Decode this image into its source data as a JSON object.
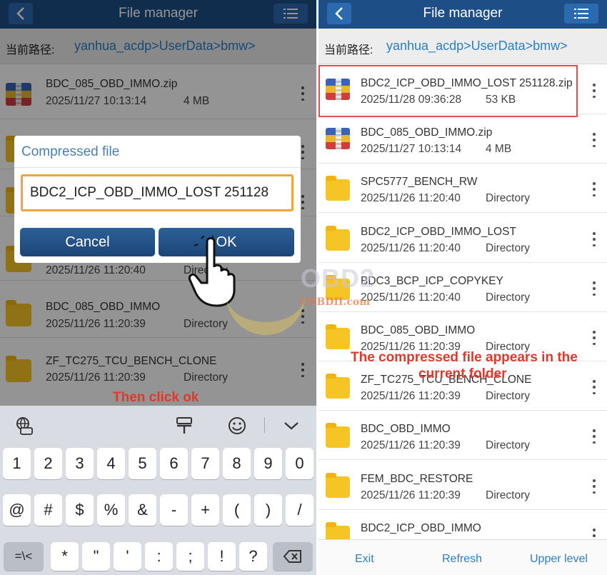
{
  "header": {
    "title": "File manager"
  },
  "path": {
    "label": "当前路径:",
    "value": "yanhua_acdp>UserData>bmw>"
  },
  "left_list": [
    {
      "name": "BDC_085_OBD_IMMO.zip",
      "date": "2025/11/27 10:13:14",
      "meta": "4 MB",
      "icon": "zip-icon"
    },
    {
      "name": "",
      "date": "2025/11/26 11:20:40",
      "meta": "Directory",
      "icon": "folder-icon"
    },
    {
      "name": "BDC_085_OBD_IMMO",
      "date": "2025/11/26 11:20:39",
      "meta": "Directory",
      "icon": "folder-icon"
    },
    {
      "name": "ZF_TC275_TCU_BENCH_CLONE",
      "date": "2025/11/26 11:20:39",
      "meta": "Directory",
      "icon": "folder-icon"
    }
  ],
  "dialog": {
    "title": "Compressed file",
    "value": "BDC2_ICP_OBD_IMMO_LOST 251128",
    "cancel_label": "Cancel",
    "ok_label": "OK"
  },
  "annotations": {
    "left": "Then click ok",
    "right_line1": "The compressed file appears in the",
    "right_line2": "current folder"
  },
  "keyboard": {
    "row1": [
      "1",
      "2",
      "3",
      "4",
      "5",
      "6",
      "7",
      "8",
      "9",
      "0"
    ],
    "row2": [
      "@",
      "#",
      "$",
      "%",
      "&",
      "-",
      "+",
      "(",
      ")",
      "/"
    ],
    "row3_switch": "=\\<",
    "row3": [
      "*",
      "\"",
      "'",
      ":",
      ";",
      "!",
      "?"
    ]
  },
  "right_list": [
    {
      "name": "BDC2_ICP_OBD_IMMO_LOST 251128.zip",
      "date": "2025/11/28 09:36:28",
      "meta": "53 KB",
      "icon": "zip-icon"
    },
    {
      "name": "BDC_085_OBD_IMMO.zip",
      "date": "2025/11/27 10:13:14",
      "meta": "4 MB",
      "icon": "zip-icon"
    },
    {
      "name": "SPC5777_BENCH_RW",
      "date": "2025/11/26 11:20:40",
      "meta": "Directory",
      "icon": "folder-icon"
    },
    {
      "name": "BDC2_ICP_OBD_IMMO_LOST",
      "date": "2025/11/26 11:20:40",
      "meta": "Directory",
      "icon": "folder-icon"
    },
    {
      "name": "BDC3_BCP_ICP_COPYKEY",
      "date": "2025/11/26 11:20:40",
      "meta": "Directory",
      "icon": "folder-icon"
    },
    {
      "name": "BDC_085_OBD_IMMO",
      "date": "2025/11/26 11:20:39",
      "meta": "Directory",
      "icon": "folder-icon"
    },
    {
      "name": "ZF_TC275_TCU_BENCH_CLONE",
      "date": "2025/11/26 11:20:39",
      "meta": "Directory",
      "icon": "folder-icon"
    },
    {
      "name": "BDC_OBD_IMMO",
      "date": "2025/11/26 11:20:39",
      "meta": "Directory",
      "icon": "folder-icon"
    },
    {
      "name": "FEM_BDC_RESTORE",
      "date": "2025/11/26 11:20:39",
      "meta": "Directory",
      "icon": "folder-icon"
    },
    {
      "name": "BDC2_ICP_OBD_IMMO",
      "date": "",
      "meta": "",
      "icon": "folder-icon"
    }
  ],
  "bottom_bar": {
    "exit": "Exit",
    "refresh": "Refresh",
    "upper": "Upper level"
  },
  "watermark": {
    "big": "OBD2",
    "small": "UOBDII.com"
  },
  "colors": {
    "header": "#1d4f86",
    "accent": "#2a7fc8",
    "highlight": "#e05050",
    "dialog_field": "#f3a33a"
  }
}
